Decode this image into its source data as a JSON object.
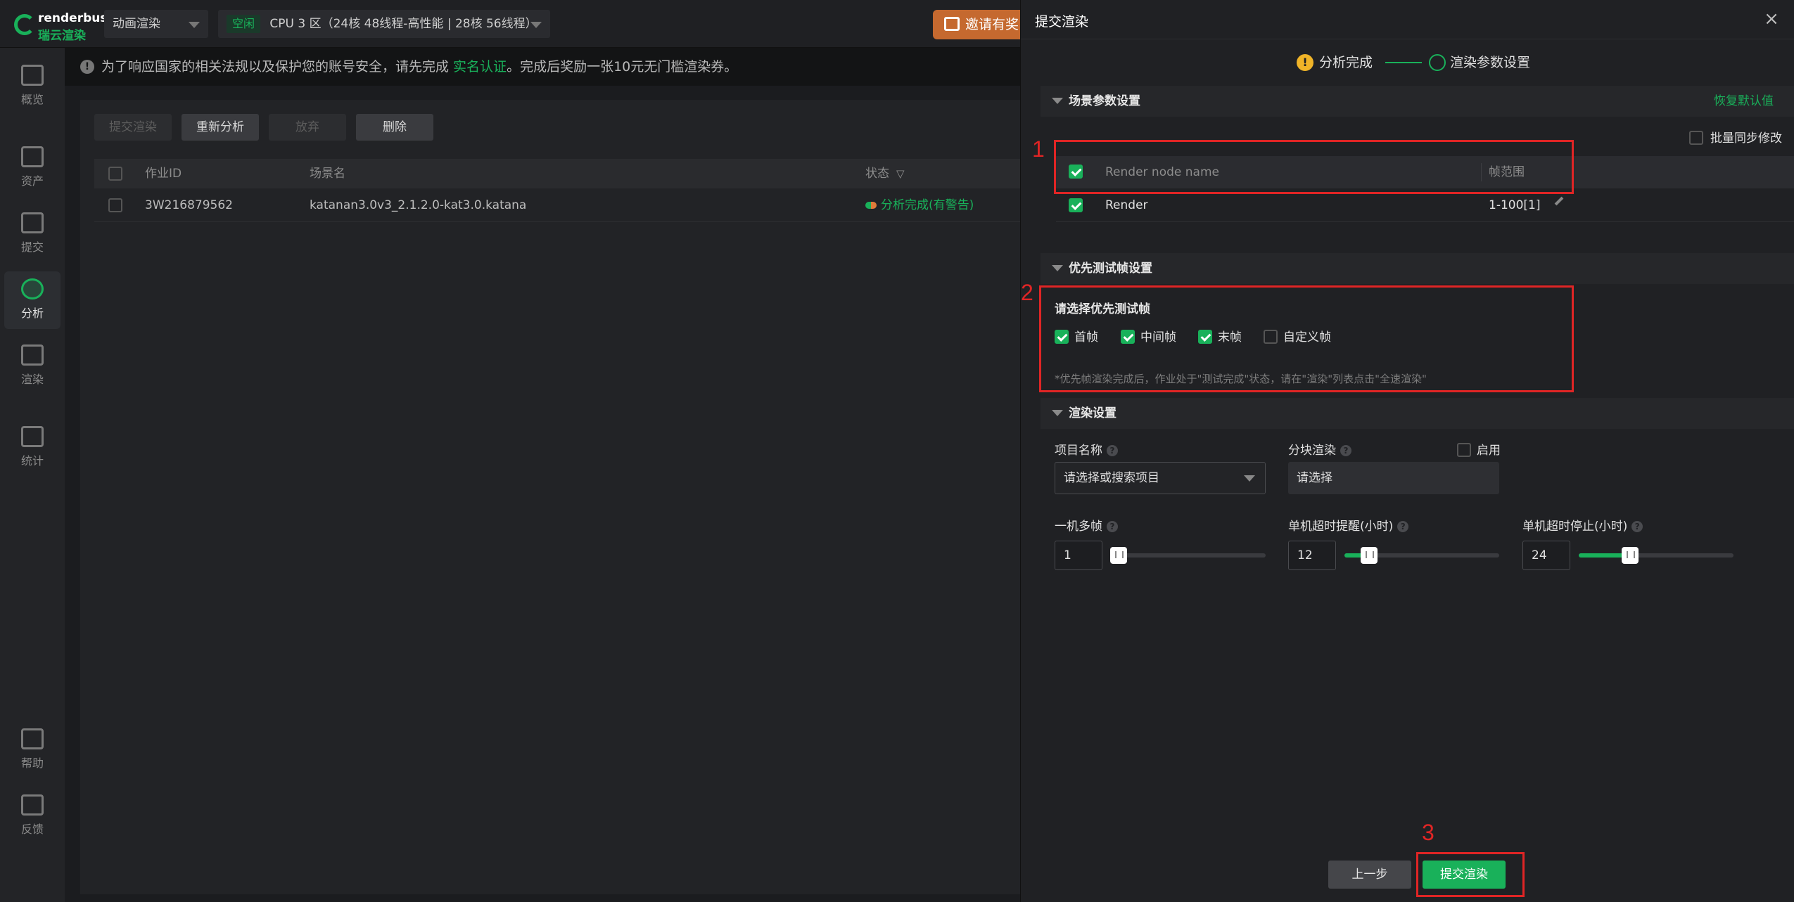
{
  "topbar": {
    "logo_en": "renderbus",
    "logo_cn": "瑞云渲染",
    "mode": "动画渲染",
    "idle": "空闲",
    "cluster": "CPU 3 区（24核 48线程-高性能 | 28核 56线程）",
    "invite": "邀请有奖"
  },
  "sidebar": {
    "items": [
      {
        "label": "概览",
        "icon": "overview-icon"
      },
      {
        "label": "资产",
        "icon": "assets-icon"
      },
      {
        "label": "提交",
        "icon": "upload-icon"
      },
      {
        "label": "分析",
        "icon": "analyze-icon"
      },
      {
        "label": "渲染",
        "icon": "render-icon"
      },
      {
        "label": "统计",
        "icon": "stats-icon"
      },
      {
        "label": "帮助",
        "icon": "help-icon"
      },
      {
        "label": "反馈",
        "icon": "feedback-icon"
      }
    ]
  },
  "notice": {
    "text_before": "为了响应国家的相关法规以及保护您的账号安全，请先完成 ",
    "link": "实名认证",
    "text_after": "。完成后奖励一张10元无门槛渲染券。"
  },
  "toolbar": {
    "submit": "提交渲染",
    "reanalyze": "重新分析",
    "discard": "放弃",
    "delete": "删除"
  },
  "jobs": {
    "headers": {
      "id": "作业ID",
      "scene": "场景名",
      "status": "状态"
    },
    "rows": [
      {
        "id": "3W216879562",
        "scene": "katanan3.0v3_2.1.2.0-kat3.0.katana",
        "status": "分析完成(有警告)"
      }
    ]
  },
  "drawer": {
    "title": "提交渲染",
    "close": "×",
    "step1": "分析完成",
    "step2": "渲染参数设置",
    "scene_section": "场景参数设置",
    "restore": "恢复默认值",
    "batch": "批量同步修改",
    "node_table": {
      "header_name": "Render node name",
      "header_range": "帧范围",
      "rows": [
        {
          "name": "Render",
          "range": "1-100[1]"
        }
      ]
    },
    "priority_section": "优先测试帧设置",
    "priority_prompt": "请选择优先测试帧",
    "frames": {
      "first": "首帧",
      "middle": "中间帧",
      "last": "末帧",
      "custom": "自定义帧"
    },
    "priority_hint": "*优先帧渲染完成后，作业处于\"测试完成\"状态，请在\"渲染\"列表点击\"全速渲染\"",
    "render_section": "渲染设置",
    "project_label": "项目名称",
    "project_placeholder": "请选择或搜索项目",
    "tile_label": "分块渲染",
    "tile_value": "请选择",
    "enable": "启用",
    "multi_label": "一机多帧",
    "multi_value": "1",
    "multi_level": 0.05,
    "warn_label": "单机超时提醒(小时)",
    "warn_value": "12",
    "warn_level": 0.16,
    "stop_label": "单机超时停止(小时)",
    "stop_value": "24",
    "stop_level": 0.33,
    "prev_btn": "上一步",
    "submit_btn": "提交渲染",
    "annotations": [
      "1",
      "2",
      "3"
    ]
  },
  "colors": {
    "accent": "#19b15a",
    "annotation": "#e02525",
    "warn": "#f0b428"
  }
}
